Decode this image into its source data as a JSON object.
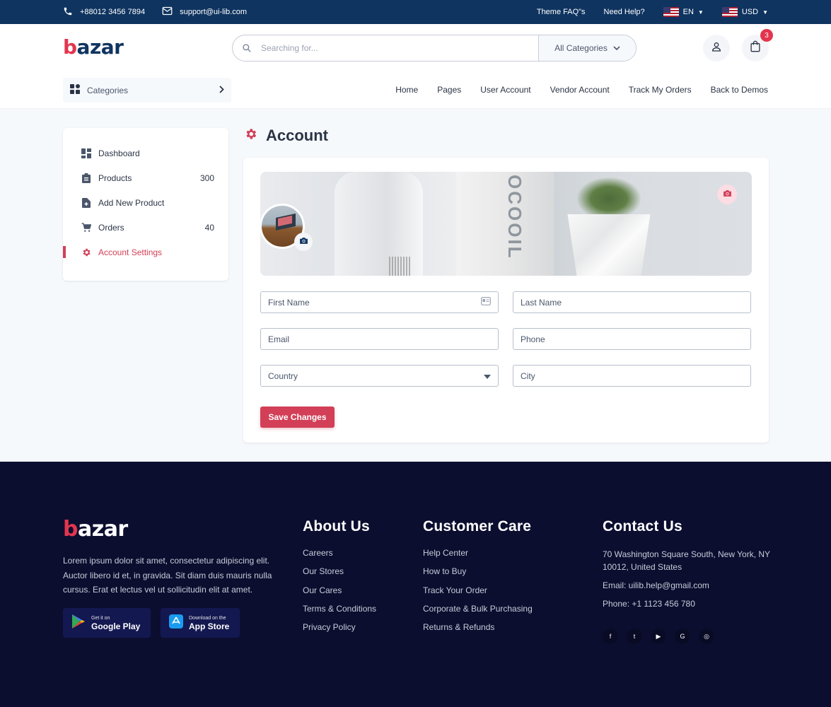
{
  "topbar": {
    "phone": "+88012 3456 7894",
    "email": "support@ui-lib.com",
    "faq": "Theme FAQ\"s",
    "help": "Need Help?",
    "language": "EN",
    "currency": "USD"
  },
  "header": {
    "logo": "bazar",
    "search_placeholder": "Searching for...",
    "category_select": "All Categories",
    "cart_count": "3",
    "categories_label": "Categories",
    "nav": [
      "Home",
      "Pages",
      "User Account",
      "Vendor Account",
      "Track My Orders",
      "Back to Demos"
    ]
  },
  "sidebar": {
    "items": [
      {
        "label": "Dashboard",
        "count": "",
        "icon": "dashboard-icon"
      },
      {
        "label": "Products",
        "count": "300",
        "icon": "clipboard-icon"
      },
      {
        "label": "Add New Product",
        "count": "",
        "icon": "file-add-icon"
      },
      {
        "label": "Orders",
        "count": "40",
        "icon": "cart-icon"
      },
      {
        "label": "Account Settings",
        "count": "",
        "icon": "gear-icon",
        "active": true
      }
    ]
  },
  "main": {
    "title": "Account",
    "cover_text": "OCOOIL",
    "form": {
      "first_name": "First Name",
      "last_name": "Last Name",
      "email": "Email",
      "phone": "Phone",
      "country": "Country",
      "city": "City"
    },
    "save_label": "Save Changes"
  },
  "footer": {
    "logo": "bazar",
    "description": "Lorem ipsum dolor sit amet, consectetur adipiscing elit. Auctor libero id et, in gravida. Sit diam duis mauris nulla cursus. Erat et lectus vel ut sollicitudin elit at amet.",
    "google_play": {
      "small": "Get it on",
      "big": "Google Play"
    },
    "app_store": {
      "small": "Download on the",
      "big": "App Store"
    },
    "about": {
      "title": "About Us",
      "links": [
        "Careers",
        "Our Stores",
        "Our Cares",
        "Terms & Conditions",
        "Privacy Policy"
      ]
    },
    "care": {
      "title": "Customer Care",
      "links": [
        "Help Center",
        "How to Buy",
        "Track Your Order",
        "Corporate & Bulk Purchasing",
        "Returns & Refunds"
      ]
    },
    "contact": {
      "title": "Contact Us",
      "address": "70 Washington Square South, New York, NY 10012, United States",
      "email": "Email: uilib.help@gmail.com",
      "phone": "Phone: +1 1123 456 780"
    },
    "social": [
      "facebook-icon",
      "twitter-icon",
      "youtube-icon",
      "google-icon",
      "instagram-icon"
    ]
  },
  "colors": {
    "primary": "#d23f57",
    "navy": "#0f3460",
    "footer": "#0c0e30"
  }
}
